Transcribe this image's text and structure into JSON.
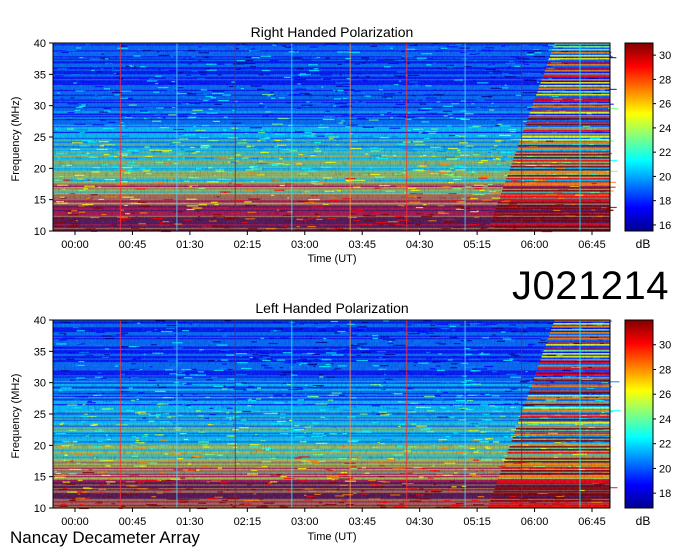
{
  "observation_id": "J021214",
  "instrument": "Nancay Decameter Array",
  "colors": {
    "colormap": [
      "#00008f",
      "#0000ff",
      "#0080ff",
      "#00ffff",
      "#80ff80",
      "#ffff00",
      "#ff8000",
      "#ff0000",
      "#800000"
    ],
    "vertical_markers": [
      "#ff3030",
      "#5ad0ff",
      "#9a2020",
      "#00ffff",
      "#ff9040"
    ]
  },
  "chart_data": [
    {
      "type": "heatmap",
      "title": "Right Handed Polarization",
      "xlabel": "Time (UT)",
      "ylabel": "Frequency (MHz)",
      "colorbar_label": "dB",
      "x_ticks": [
        "00:00",
        "00:45",
        "01:30",
        "02:15",
        "03:00",
        "03:45",
        "04:30",
        "05:15",
        "06:00",
        "06:45"
      ],
      "y_ticks": [
        10,
        15,
        20,
        25,
        30,
        35,
        40
      ],
      "ylim": [
        10,
        40
      ],
      "colorbar_ticks": [
        16,
        18,
        20,
        22,
        24,
        26,
        28,
        30
      ],
      "colorbar_range": [
        15.5,
        31
      ]
    },
    {
      "type": "heatmap",
      "title": "Left Handed Polarization",
      "xlabel": "Time (UT)",
      "ylabel": "Frequency (MHz)",
      "colorbar_label": "dB",
      "x_ticks": [
        "00:00",
        "00:45",
        "01:30",
        "02:15",
        "03:00",
        "03:45",
        "04:30",
        "05:15",
        "06:00",
        "06:45"
      ],
      "y_ticks": [
        10,
        15,
        20,
        25,
        30,
        35,
        40
      ],
      "ylim": [
        10,
        40
      ],
      "colorbar_ticks": [
        18,
        20,
        22,
        24,
        26,
        28,
        30
      ],
      "colorbar_range": [
        16.8,
        32
      ]
    }
  ]
}
